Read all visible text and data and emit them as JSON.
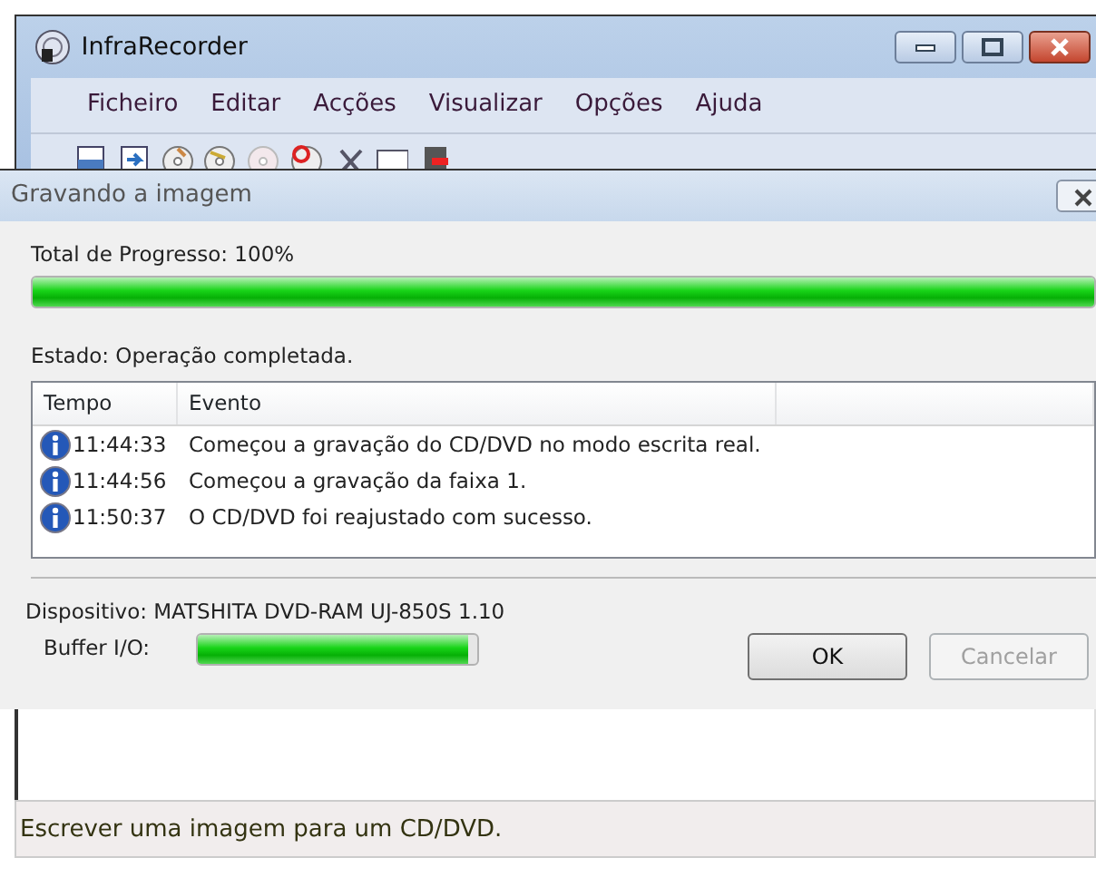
{
  "main_window": {
    "title": "InfraRecorder",
    "menu": [
      "Ficheiro",
      "Editar",
      "Acções",
      "Visualizar",
      "Opções",
      "Ajuda"
    ],
    "status_bar": "Escrever uma imagem para um CD/DVD."
  },
  "dialog": {
    "title": "Gravando a imagem",
    "total_progress": {
      "label": "Total de Progresso: 100%",
      "level": 1.0
    },
    "status": "Estado: Operação completada.",
    "log": {
      "columns": [
        "Tempo",
        "Evento"
      ],
      "rows": [
        {
          "time": "11:44:33",
          "event": "Começou a gravação do CD/DVD no modo escrita real."
        },
        {
          "time": "11:44:56",
          "event": "Começou a gravação da faixa 1."
        },
        {
          "time": "11:50:37",
          "event": "O CD/DVD foi reajustado com sucesso."
        }
      ]
    },
    "device": "Dispositivo: MATSHITA DVD-RAM UJ-850S 1.10",
    "buffer": {
      "label": "Buffer I/O:",
      "level": 0.97
    },
    "buttons": [
      {
        "label": "OK",
        "disabled": false
      },
      {
        "label": "Cancelar",
        "disabled": true
      }
    ]
  }
}
